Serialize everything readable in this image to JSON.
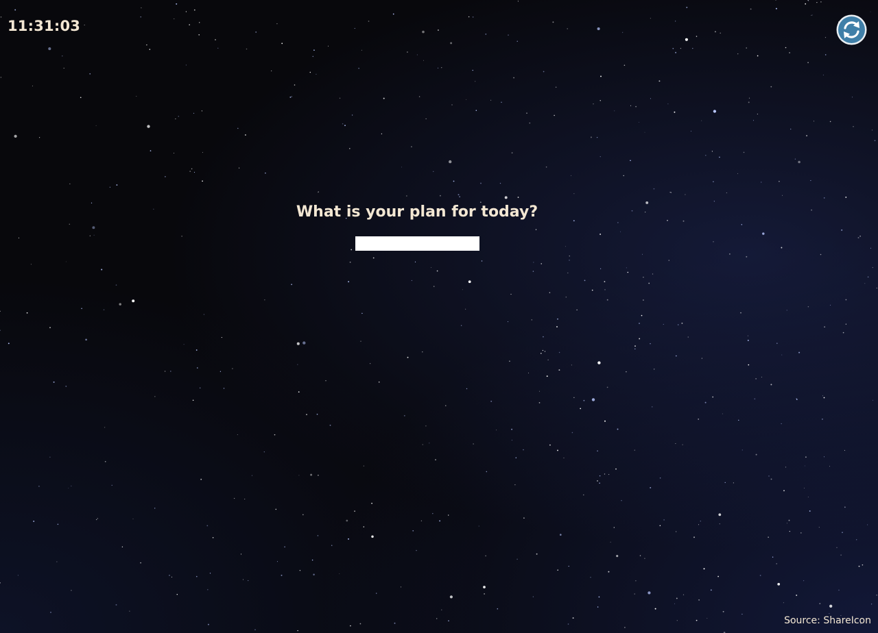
{
  "clock": {
    "time": "11:31:03"
  },
  "refresh": {
    "icon": "refresh-icon"
  },
  "focus": {
    "question": "What is your plan for today?",
    "input_value": ""
  },
  "footer": {
    "source": "Source: ShareIcon"
  },
  "colors": {
    "text": "#f3e7d3",
    "background": "#08080c",
    "refresh_fill": "#3f7fa8",
    "input_bg": "#ffffff"
  }
}
